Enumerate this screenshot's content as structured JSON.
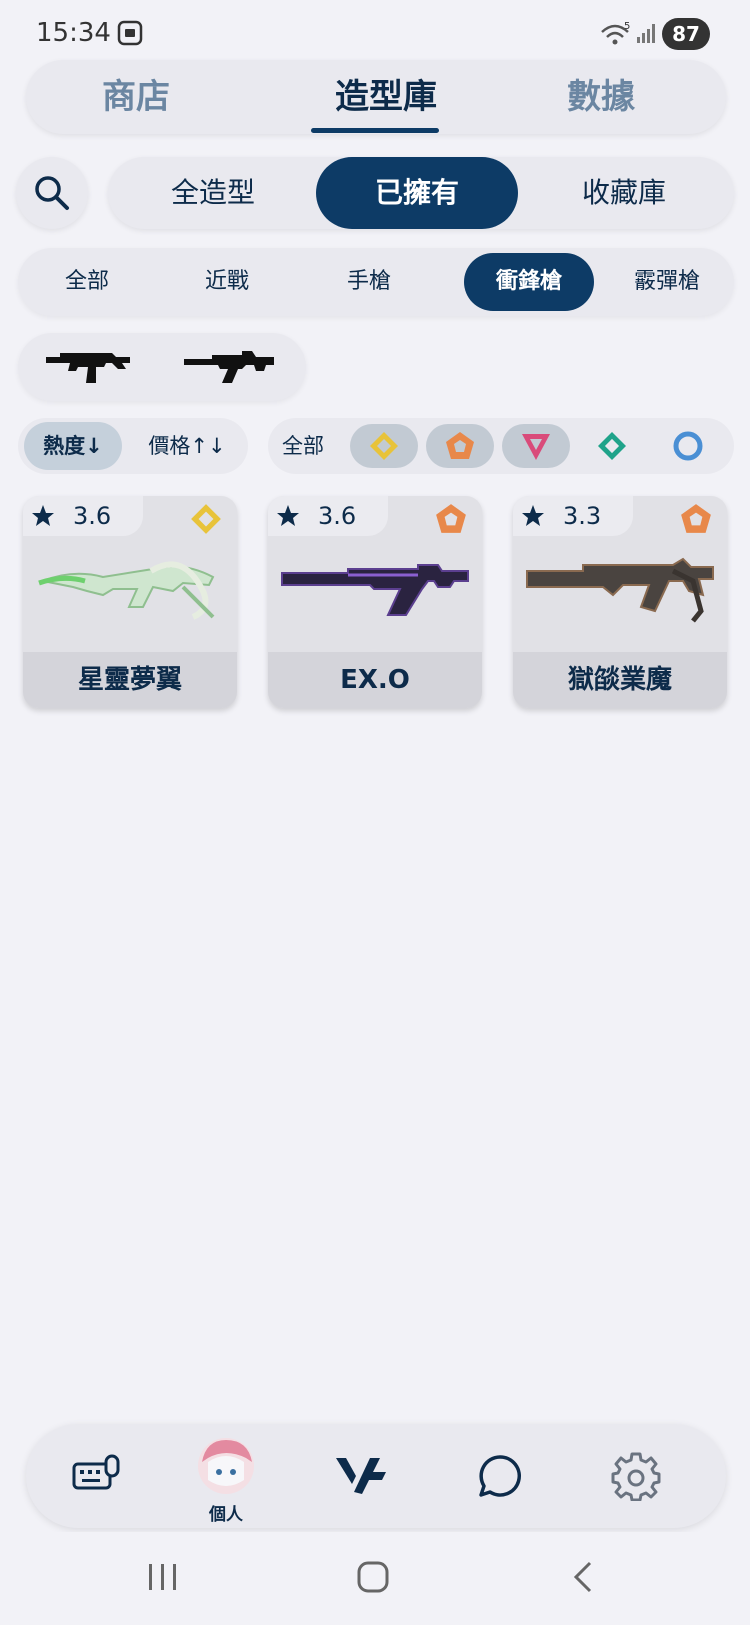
{
  "status_bar": {
    "time": "15:34",
    "battery": "87",
    "wifi_badge": "5"
  },
  "top_tabs": [
    {
      "label": "商店",
      "active": false
    },
    {
      "label": "造型庫",
      "active": true
    },
    {
      "label": "數據",
      "active": false
    }
  ],
  "filter_segments": [
    {
      "label": "全造型",
      "active": false
    },
    {
      "label": "已擁有",
      "active": true
    },
    {
      "label": "收藏庫",
      "active": false
    }
  ],
  "categories": [
    {
      "label": "全部",
      "active": false
    },
    {
      "label": "近戰",
      "active": false
    },
    {
      "label": "手槍",
      "active": false
    },
    {
      "label": "衝鋒槍",
      "active": true
    },
    {
      "label": "霰彈槍",
      "active": false
    }
  ],
  "weapons": [
    {
      "icon": "smg-stinger-icon"
    },
    {
      "icon": "smg-spectre-icon"
    }
  ],
  "sort": {
    "popularity_label": "熱度↓",
    "price_label": "價格↑↓"
  },
  "tier_filter": {
    "all_label": "全部",
    "tiers": [
      {
        "icon": "premium-tier-icon",
        "color": "#e8c33a",
        "selected": true
      },
      {
        "icon": "exclusive-tier-icon",
        "color": "#e8884a",
        "selected": true
      },
      {
        "icon": "ultra-tier-icon",
        "color": "#d94b7a",
        "selected": true
      },
      {
        "icon": "deluxe-tier-icon",
        "color": "#1fa38a",
        "selected": false
      },
      {
        "icon": "select-tier-icon",
        "color": "#4a8fd4",
        "selected": false
      }
    ]
  },
  "skins": [
    {
      "rating": "3.6",
      "name": "星靈夢翼",
      "tier": "premium",
      "tier_color": "#e8c33a",
      "image": "green-white-smg"
    },
    {
      "rating": "3.6",
      "name": "EX.O",
      "tier": "exclusive",
      "tier_color": "#e8884a",
      "image": "purple-black-smg"
    },
    {
      "rating": "3.3",
      "name": "獄燄業魔",
      "tier": "exclusive",
      "tier_color": "#e8884a",
      "image": "dark-bronze-smg"
    }
  ],
  "bottom_nav": {
    "items": [
      {
        "icon": "keyboard-mouse-icon"
      },
      {
        "icon": "avatar",
        "label": "個人"
      },
      {
        "icon": "app-logo-icon"
      },
      {
        "icon": "chat-icon"
      },
      {
        "icon": "gear-icon"
      }
    ]
  }
}
